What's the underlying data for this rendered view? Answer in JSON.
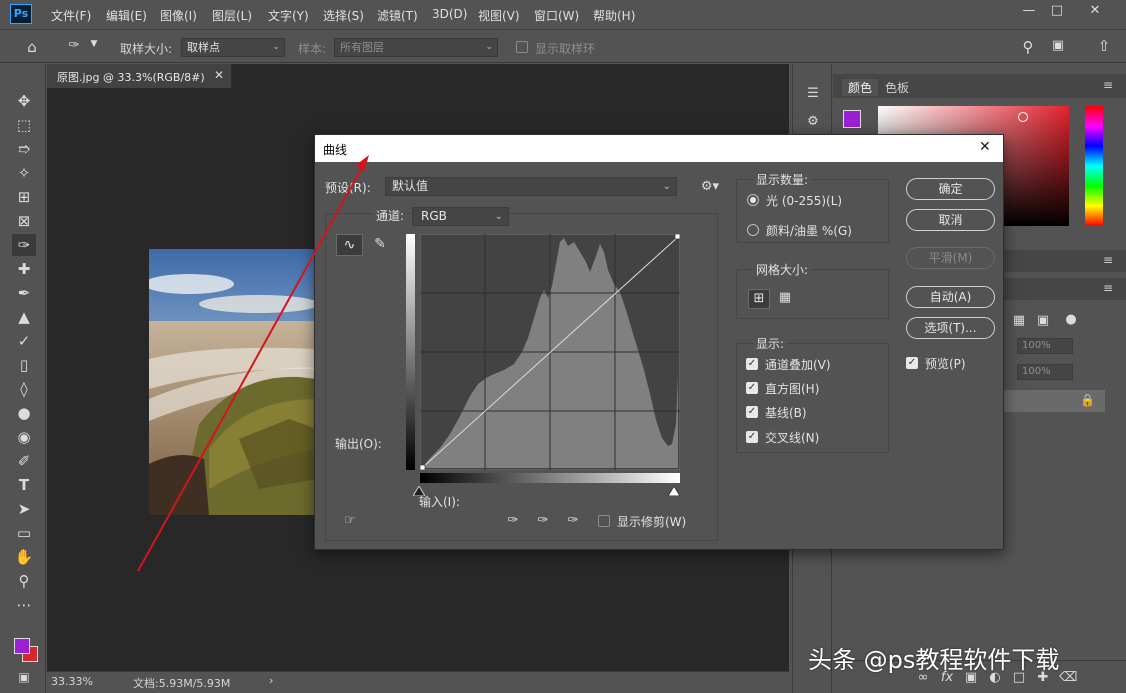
{
  "app": {
    "logo": "Ps",
    "menu": [
      "文件(F)",
      "编辑(E)",
      "图像(I)",
      "图层(L)",
      "文字(Y)",
      "选择(S)",
      "滤镜(T)",
      "3D(D)",
      "视图(V)",
      "窗口(W)",
      "帮助(H)"
    ]
  },
  "options_bar": {
    "sample_size_label": "取样大小:",
    "sample_size_value": "取样点",
    "sample_label": "样本:",
    "sample_value": "所有图层",
    "show_ring_label": "显示取样环"
  },
  "document": {
    "tab_title": "原图.jpg @ 33.3%(RGB/8#)",
    "zoom": "33.33%",
    "doc_size": "文档:5.93M/5.93M"
  },
  "panels": {
    "color_tab": "颜色",
    "swatches_tab": "色板",
    "opacity_1": "100%",
    "opacity_2": "100%"
  },
  "curves": {
    "title": "曲线",
    "preset_label": "预设(R):",
    "preset_value": "默认值",
    "channel_label": "通道:",
    "channel_value": "RGB",
    "output_label": "输出(O):",
    "input_label": "输入(I):",
    "show_clipping": "显示修剪(W)",
    "show_amount_title": "显示数量:",
    "light_option": "光 (0-255)(L)",
    "pigment_option": "颜料/油墨 %(G)",
    "grid_size_title": "网格大小:",
    "show_title": "显示:",
    "channel_overlay": "通道叠加(V)",
    "histogram": "直方图(H)",
    "baseline": "基线(B)",
    "intersection": "交叉线(N)",
    "ok": "确定",
    "cancel": "取消",
    "smooth": "平滑(M)",
    "auto": "自动(A)",
    "options": "选项(T)...",
    "preview": "预览(P)"
  },
  "watermark": "头条 @ps教程软件下载",
  "colors": {
    "foreground": "#9b1fd6",
    "background": "#d8262d",
    "annotation_arrow": "#d4141c"
  }
}
